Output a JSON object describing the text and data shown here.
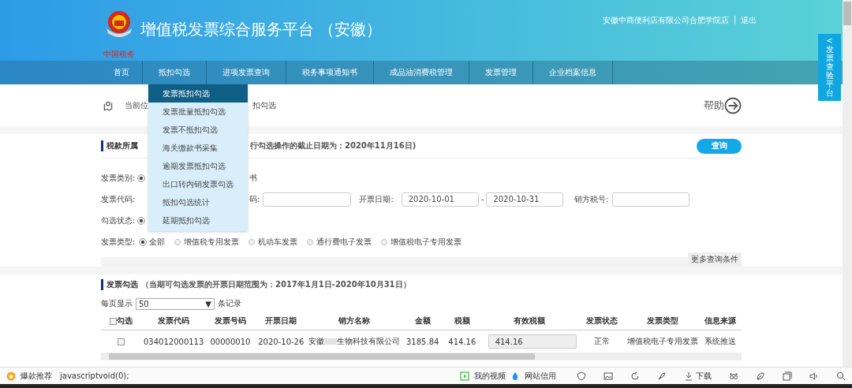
{
  "header": {
    "emblem_text": "中国税务",
    "title": "增值税发票综合服务平台 （安徽）",
    "user": "安徽中商便利店有限公司合肥学院店",
    "separator": "|",
    "logout": "退出"
  },
  "nav": [
    "首页",
    "抵扣勾选",
    "进项发票查询",
    "税务事项通知书",
    "成品油消费税管理",
    "发票管理",
    "企业档案信息"
  ],
  "side_tab": {
    "arrow": "<",
    "label": "发票查验平台"
  },
  "dropdown": [
    {
      "label": "发票抵扣勾选",
      "selected": true
    },
    {
      "label": "发票批量抵扣勾选",
      "selected": false
    },
    {
      "label": "发票不抵扣勾选",
      "selected": false
    },
    {
      "label": "海关缴款书采集",
      "selected": false
    },
    {
      "label": "逾期发票抵扣勾选",
      "selected": false
    },
    {
      "label": "出口转内销发票勾选",
      "selected": false
    },
    {
      "label": "抵扣勾选统计",
      "selected": false
    },
    {
      "label": "延期抵扣勾选",
      "selected": false
    }
  ],
  "breadcrumb": {
    "left": "当前位",
    "right": "扣勾选"
  },
  "help": "帮助",
  "filter_panel": {
    "title": "税款所属",
    "note": "行勾选操作的截止日期为：2020年11月16日)",
    "query_button": "查询",
    "category": {
      "label": "发票类别:",
      "selected": true,
      "tail": "书"
    },
    "code": {
      "label": "发票代码:",
      "number_label": "码:",
      "date_label": "开票日期:",
      "date_from": "2020-10-01",
      "date_sep": "-",
      "date_to": "2020-10-31",
      "seller_label": "销方税号:"
    },
    "status": {
      "label": "勾选状态:",
      "selected": true
    },
    "type": {
      "label": "发票类型:",
      "options": [
        {
          "label": "全部",
          "selected": true
        },
        {
          "label": "增值税专用发票",
          "selected": false
        },
        {
          "label": "机动车发票",
          "selected": false
        },
        {
          "label": "通行费电子发票",
          "selected": false
        },
        {
          "label": "增值税电子专用发票",
          "selected": false
        }
      ]
    },
    "more": "更多查询条件"
  },
  "table_panel": {
    "title": "发票勾选",
    "note": "（当期可勾选发票的开票日期范围为：2017年1月1日-2020年10月31日）",
    "per_page_label": "每页显示",
    "per_page": "50",
    "per_page_caret": "▼",
    "per_page_unit": "条记录",
    "columns": [
      {
        "label": "勾选",
        "checked": false
      },
      {
        "label": "发票代码"
      },
      {
        "label": "发票号码"
      },
      {
        "label": "开票日期"
      },
      {
        "label": "销方名称"
      },
      {
        "label": "金额"
      },
      {
        "label": "税额"
      },
      {
        "label": "有效税额"
      },
      {
        "label": "发票状态"
      },
      {
        "label": "发票类型"
      },
      {
        "label": "信息来源"
      }
    ],
    "rows": [
      {
        "checked": false,
        "code": "034012000113",
        "number": "00000010",
        "date": "2020-10-26",
        "seller_prefix": "安徽",
        "seller_suffix": "生物科技有限公司",
        "amount": "3185.84",
        "tax": "414.16",
        "effective_tax": "414.16",
        "status": "正常",
        "type": "增值税电子专用发票",
        "source": "系统推送"
      }
    ]
  },
  "browser_bar": {
    "promo": "爆款推荐",
    "url": "javascriptvoid(0);",
    "video": "我的视频",
    "credit": "网站信用",
    "download": "下载"
  }
}
